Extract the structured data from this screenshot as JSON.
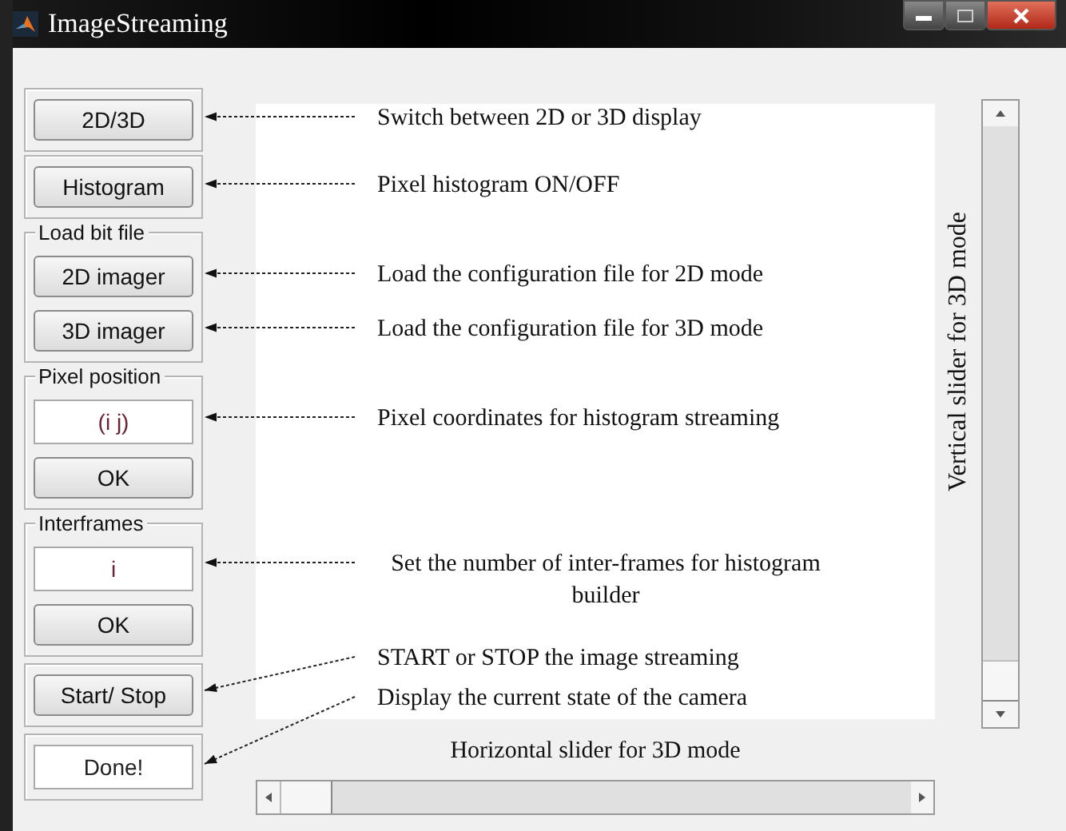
{
  "window": {
    "title": "ImageStreaming"
  },
  "panels": [
    {
      "items": [
        {
          "kind": "button",
          "label": "2D/3D"
        }
      ]
    },
    {
      "items": [
        {
          "kind": "button",
          "label": "Histogram"
        }
      ]
    },
    {
      "legend": "Load bit file",
      "items": [
        {
          "kind": "button",
          "label": "2D imager"
        },
        {
          "kind": "button",
          "label": "3D imager"
        }
      ]
    },
    {
      "legend": "Pixel position",
      "items": [
        {
          "kind": "field",
          "value": "(i j)"
        },
        {
          "kind": "button",
          "label": "OK"
        }
      ]
    },
    {
      "legend": "Interframes",
      "items": [
        {
          "kind": "field",
          "value": "i"
        },
        {
          "kind": "button",
          "label": "OK"
        }
      ]
    },
    {
      "items": [
        {
          "kind": "button",
          "label": "Start/ Stop"
        }
      ]
    },
    {
      "items": [
        {
          "kind": "display",
          "value": "Done!"
        }
      ]
    }
  ],
  "annotations": [
    {
      "text": "Switch between 2D or 3D display"
    },
    {
      "text": "Pixel histogram ON/OFF"
    },
    {
      "text": "Load the configuration file for 2D mode"
    },
    {
      "text": "Load the configuration file for 3D mode"
    },
    {
      "text": "Pixel coordinates for histogram streaming"
    },
    {
      "text": "Set the number of inter-frames for histogram builder"
    },
    {
      "text": "START or STOP the image streaming"
    },
    {
      "text": "Display the current state of the camera"
    }
  ],
  "vertical_slider": {
    "label": "Vertical slider for 3D mode",
    "level": 0
  },
  "horizontal_slider": {
    "label": "Horizontal slider for 3D mode",
    "level": 0
  }
}
